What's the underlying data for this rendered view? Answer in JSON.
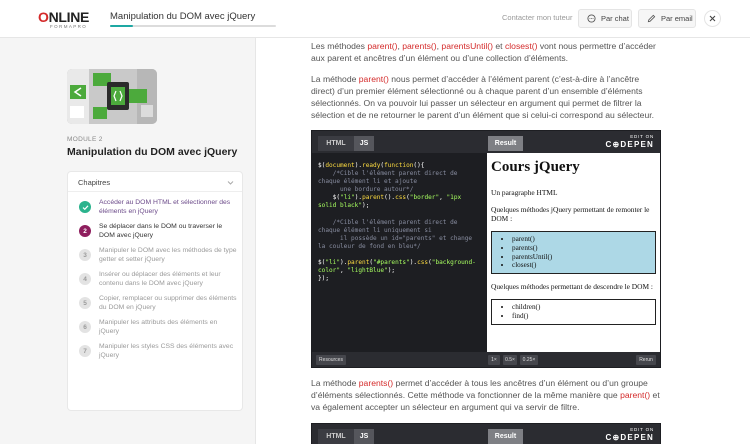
{
  "header": {
    "logo_first": "O",
    "logo_rest": "NLINE",
    "logo_sub": "FORMAPRO",
    "course_title": "Manipulation du DOM avec jQuery",
    "progress_fraction": 0.14,
    "tutor_link": "Contacter mon tuteur",
    "chat_label": "Par chat",
    "email_label": "Par email"
  },
  "sidebar": {
    "module_label": "MODULE 2",
    "module_title": "Manipulation du DOM avec jQuery",
    "chapters_title": "Chapitres",
    "chapters": [
      {
        "badge": "",
        "status": "done",
        "label": "Accéder au DOM HTML et sélectionner des éléments en jQuery"
      },
      {
        "badge": "2",
        "status": "current",
        "label": "Se déplacer dans le DOM ou traverser le DOM avec jQuery"
      },
      {
        "badge": "3",
        "status": "todo",
        "label": "Manipuler le DOM avec les méthodes de type getter et setter jQuery"
      },
      {
        "badge": "4",
        "status": "todo",
        "label": "Insérer ou déplacer des éléments et leur contenu dans le DOM avec jQuery"
      },
      {
        "badge": "5",
        "status": "todo",
        "label": "Copier, remplacer ou supprimer des éléments du DOM en jQuery"
      },
      {
        "badge": "6",
        "status": "todo",
        "label": "Manipuler les attributs des éléments en jQuery"
      },
      {
        "badge": "7",
        "status": "todo",
        "label": "Manipuler les styles CSS des éléments avec jQuery"
      }
    ]
  },
  "content": {
    "p1": {
      "t1": "Les méthodes ",
      "m1": "parent()",
      "t2": ", ",
      "m2": "parents()",
      "t3": ", ",
      "m3": "parentsUntil()",
      "t4": " et ",
      "m4": "closest()",
      "t5": " vont nous permettre d’accéder aux parent et ancêtres d’un élément ou d’une collection d’éléments."
    },
    "p2": {
      "t1": "La méthode ",
      "m1": "parent()",
      "t2": " nous permet d’accéder à l’élément parent (c’est-à-dire à l’ancêtre direct) d’un premier élément sélectionné ou à chaque parent d’un ensemble d’éléments sélectionnés. On va pouvoir lui passer un sélecteur en argument qui permet de filtrer la sélection et de ne retourner le parent d’un élément que si celui-ci correspond au sélecteur."
    },
    "p3": {
      "t1": "La méthode ",
      "m1": "parents()",
      "t2": " permet d’accéder à tous les ancêtres d’un élément ou d’un groupe d’éléments sélectionnés. Cette méthode va fonctionner de la même manière que ",
      "m2": "parent()",
      "t3": " et va également accepter un sélecteur en argument qui va servir de filtre."
    }
  },
  "codepen": {
    "tab_html": "HTML",
    "tab_js": "JS",
    "tab_result": "Result",
    "logo_top": "EDIT ON",
    "logo_main": "C⊕DEPEN",
    "code": {
      "l1a": "$(",
      "l1b": "document",
      "l1c": ").",
      "l1d": "ready",
      "l1e": "(",
      "l1f": "function",
      "l1g": "(){",
      "c1": "    /*Cible l'élément parent direct de chaque élément li et ajoute\n      une bordure autour*/",
      "l2a": "    $(",
      "l2b": "\"li\"",
      "l2c": ").",
      "l2d": "parent",
      "l2e": "().",
      "l2f": "css",
      "l2g": "(",
      "l2h": "\"border\"",
      "l2i": ", ",
      "l2j": "\"1px solid black\"",
      "l2k": ");",
      "c2": "    /*Cible l'élément parent direct de chaque élément li uniquement si\n      il possède un id=\"parents\" et change la couleur de fond en bleu*/",
      "l3a": "$(",
      "l3b": "\"li\"",
      "l3c": ").",
      "l3d": "parent",
      "l3e": "(",
      "l3f": "\"#parents\"",
      "l3g": ").",
      "l3h": "css",
      "l3i": "(",
      "l3j": "\"background-color\"",
      "l3k": ", ",
      "l3l": "\"lightBlue\"",
      "l3m": ");",
      "l4": "});"
    },
    "result": {
      "h1": "Cours jQuery",
      "p1": "Un paragraphe HTML",
      "p2": "Quelques méthodes jQuery permettant de remonter le DOM :",
      "list1": [
        "parent()",
        "parents()",
        "parentsUntil()",
        "closest()"
      ],
      "p3": "Quelques méthodes permettant de descendre le DOM :",
      "list2": [
        "children()",
        "find()"
      ]
    },
    "resources": "Resources",
    "zoom": [
      "1×",
      "0.5×",
      "0.25×"
    ],
    "rerun": "Rerun"
  },
  "colors": {
    "accent_red": "#d42a2a",
    "progress_teal": "#1ea8a3",
    "done_green": "#2bb38d",
    "current_purple": "#8e1e5e"
  }
}
